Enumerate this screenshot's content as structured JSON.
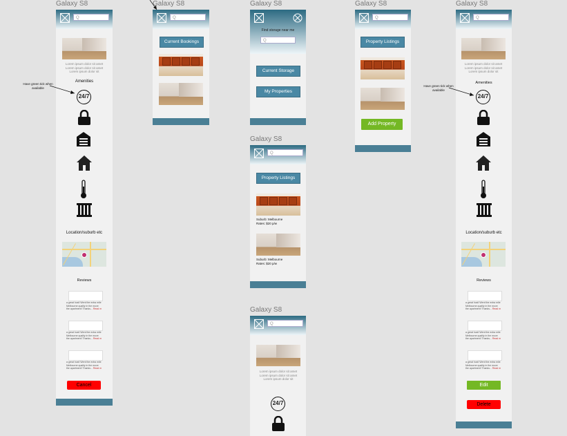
{
  "device_label": "Galaxy S8",
  "search_placeholder": "Q",
  "lorem": "Lorem ipsum dolor sit amet Lorem ipsum dolor sit amet Lorem ipsum dolor sit",
  "screen1": {
    "amenities_title": "Amenities",
    "annotation": "Have green tick when available",
    "badge_247": "24/7",
    "location_title": "Location/suburb etc",
    "reviews_title": "Reviews",
    "review_snippet_1": "a great host! Went the extra mile",
    "review_snippet_2": "Melbourne quality in the move",
    "review_snippet_3": "the apartment! Thanks...",
    "read_more": "Read m",
    "cancel_label": "Cancel"
  },
  "screen2": {
    "current_bookings_label": "Current Bookings"
  },
  "screen3": {
    "find_storage_label": "Find storage near me",
    "current_storage_label": "Current Storage",
    "my_properties_label": "My Properties"
  },
  "screen4": {
    "property_listings_label": "Property Listings",
    "listing1_suburb": "Suburb: Melbourne",
    "listing1_rates": "Rates: $20 p/w",
    "listing2_suburb": "Suburb: Melbourne",
    "listing2_rates": "Rates: $20 p/w"
  },
  "screen5": {
    "badge_247": "24/7"
  },
  "screen6": {
    "property_listings_label": "Property Listings",
    "add_property_label": "Add Property"
  },
  "screen7": {
    "amenities_title": "Amenities",
    "annotation": "Have green tick when available",
    "badge_247": "24/7",
    "location_title": "Location/suburb etc",
    "reviews_title": "Reviews",
    "edit_label": "Edit",
    "delete_label": "Delete"
  },
  "colors": {
    "header": "#2c6a82",
    "button_blue": "#4a88a4",
    "button_green": "#74b824",
    "button_red": "#ff0000",
    "footer": "#4a7f95"
  }
}
